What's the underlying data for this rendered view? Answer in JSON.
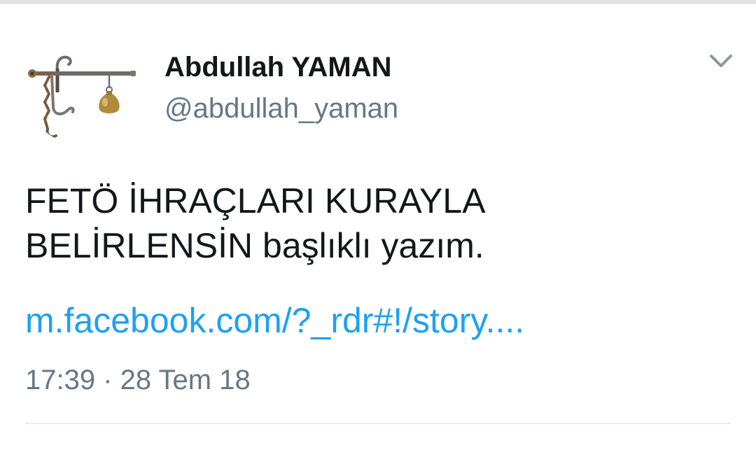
{
  "tweet": {
    "author": {
      "display_name": "Abdullah YAMAN",
      "handle": "@abdullah_yaman",
      "avatar_icon": "balance-scale-icon"
    },
    "text_lines": [
      "FETÖ İHRAÇLARI KURAYLA",
      "BELİRLENSİN başlıklı yazım."
    ],
    "link_text": "m.facebook.com/?_rdr#!/story....",
    "timestamp": "17:39 · 28 Tem 18",
    "menu_icon": "chevron-down-icon"
  },
  "colors": {
    "name": "#14171a",
    "secondary": "#657786",
    "link": "#1da1f2",
    "divider": "#e6ecf0"
  }
}
